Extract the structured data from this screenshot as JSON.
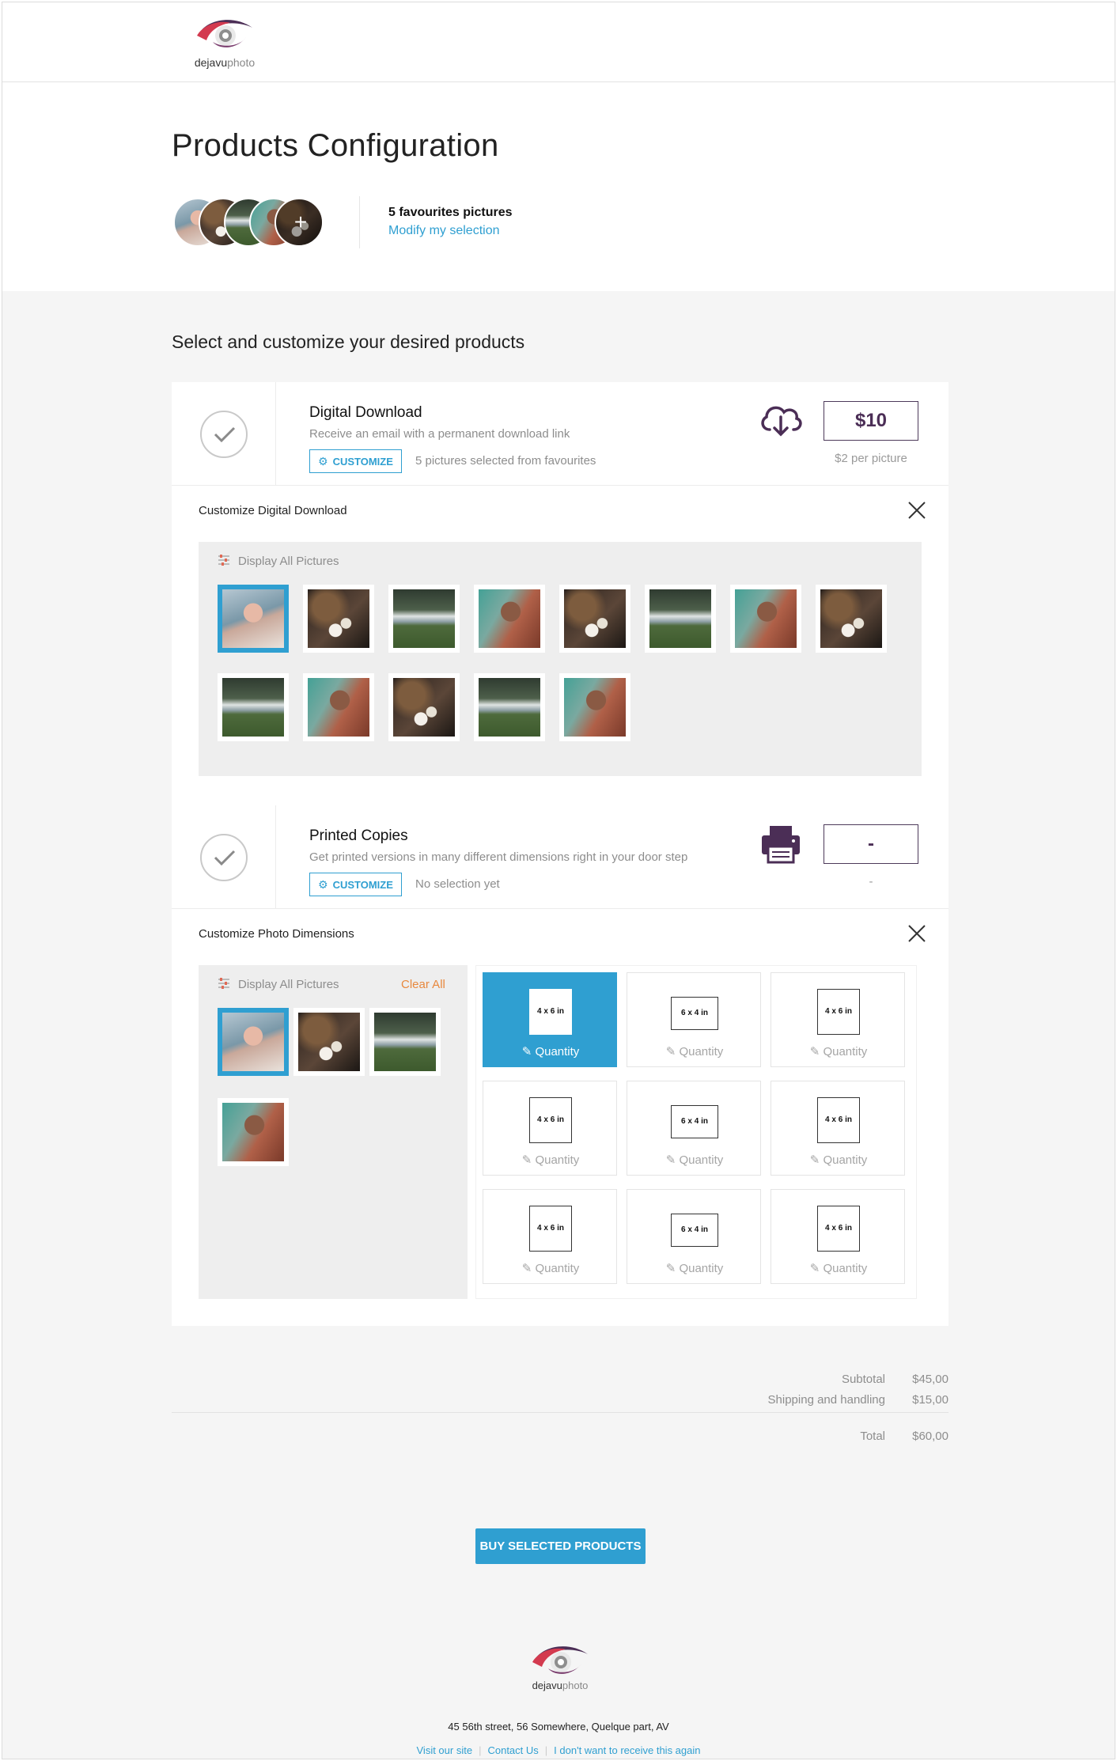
{
  "brand": {
    "name_bold": "dejavu",
    "name_light": "photo"
  },
  "header": {
    "title": "Products Configuration"
  },
  "favourites": {
    "count_label": "5 favourites pictures",
    "modify_label": "Modify my selection",
    "more_icon": "+"
  },
  "section_title": "Select and customize your desired products",
  "digital": {
    "name": "Digital Download",
    "description": "Receive an email with a permanent download link",
    "customize_label": "CUSTOMIZE",
    "meta": "5 pictures selected from favourites",
    "price": "$10",
    "price_note": "$2 per picture",
    "icon": "cloud-download-icon",
    "customize_title": "Customize Digital Download",
    "filter_label": "Display All Pictures"
  },
  "printed": {
    "name": "Printed Copies",
    "description": "Get printed versions in many different dimensions right in your door step",
    "customize_label": "CUSTOMIZE",
    "meta": "No selection yet",
    "price": "-",
    "price_note": "-",
    "icon": "printer-icon",
    "customize_title": "Customize Photo Dimensions",
    "filter_label": "Display All Pictures",
    "clear_label": "Clear All",
    "sizes": [
      {
        "label": "4 x 6 in",
        "qty": "Quantity"
      },
      {
        "label": "6 x 4 in",
        "qty": "Quantity"
      },
      {
        "label": "4 x 6 in",
        "qty": "Quantity"
      },
      {
        "label": "4 x 6 in",
        "qty": "Quantity"
      },
      {
        "label": "6 x 4 in",
        "qty": "Quantity"
      },
      {
        "label": "4 x 6 in",
        "qty": "Quantity"
      },
      {
        "label": "4 x 6 in",
        "qty": "Quantity"
      },
      {
        "label": "6 x 4 in",
        "qty": "Quantity"
      },
      {
        "label": "4 x 6 in",
        "qty": "Quantity"
      }
    ]
  },
  "totals": {
    "subtotal_label": "Subtotal",
    "subtotal": "$45,00",
    "shipping_label": "Shipping and handling",
    "shipping": "$15,00",
    "total_label": "Total",
    "total": "$60,00"
  },
  "buy_label": "BUY SELECTED PRODUCTS",
  "footer": {
    "address": "45 56th street, 56 Somewhere, Quelque part, AV",
    "links": [
      "Visit our site",
      "Contact Us",
      "I don't want to receive this again"
    ]
  },
  "colors": {
    "accent": "#2f9fd1",
    "brand_purple": "#4b2e56",
    "warning": "#e8883d"
  }
}
